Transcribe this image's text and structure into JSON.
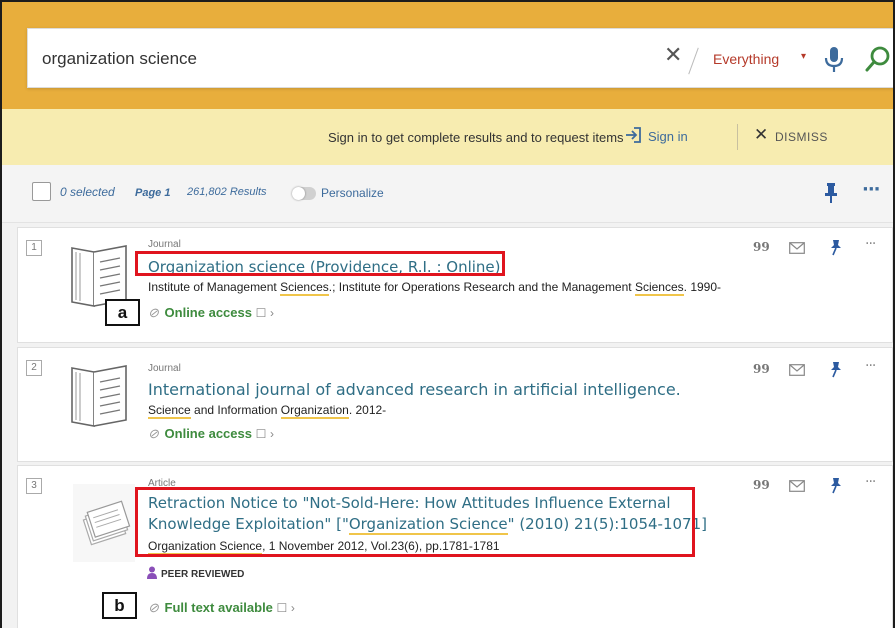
{
  "search": {
    "query": "organization science",
    "clear_glyph": "✕",
    "scope": "Everything",
    "caret_glyph": "▾"
  },
  "signin_banner": {
    "message": "Sign in to get complete results and to request items",
    "signin_label": "Sign in",
    "dismiss_glyph": "✕",
    "dismiss_label": "DISMISS"
  },
  "toolbar": {
    "selected": "0 selected",
    "page": "Page 1",
    "results": "261,802 Results",
    "personalize": "Personalize",
    "more_glyph": "···"
  },
  "results": [
    {
      "number": "1",
      "type": "Journal",
      "title": "Organization science (Providence, R.I. : Online)",
      "desc_parts": [
        "Institute of Management ",
        "Sciences",
        ".; Institute for Operations Research and the Management ",
        "Sciences",
        ". 1990-"
      ],
      "access": "Online access",
      "thumbnail": "book-icon"
    },
    {
      "number": "2",
      "type": "Journal",
      "title": "International journal of advanced research in artificial intelligence.",
      "desc_parts": [
        "Science",
        " and Information ",
        "Organization",
        ". 2012-"
      ],
      "access": "Online access",
      "thumbnail": "book-icon"
    },
    {
      "number": "3",
      "type": "Article",
      "title_parts": [
        "Retraction Notice to \"Not-Sold-Here: How Attitudes Influence External Knowledge Exploitation\" [\"",
        "Organization Science",
        "\" (2010) 21(5):1054-1071]"
      ],
      "desc_parts": [
        "Organization Science",
        ", 1 November 2012, Vol.23(6), pp.1781-1781"
      ],
      "badge": "PEER REVIEWED",
      "access": "Full text available",
      "thumbnail": "article-icon"
    }
  ],
  "item_actions": {
    "quote_glyph": "99",
    "more_glyph": "···"
  },
  "access_glyphs": {
    "link": "⊘",
    "external": "☐",
    "chevron": "›"
  },
  "callouts": {
    "a": "a",
    "b": "b"
  },
  "colors": {
    "search_band": "#e8ae3c",
    "signin_band": "#f7ecb0",
    "title_link": "#2f6e85",
    "access_green": "#3e8b3e",
    "accent_blue": "#3d6b9c",
    "highlight_red": "#e0141e"
  }
}
